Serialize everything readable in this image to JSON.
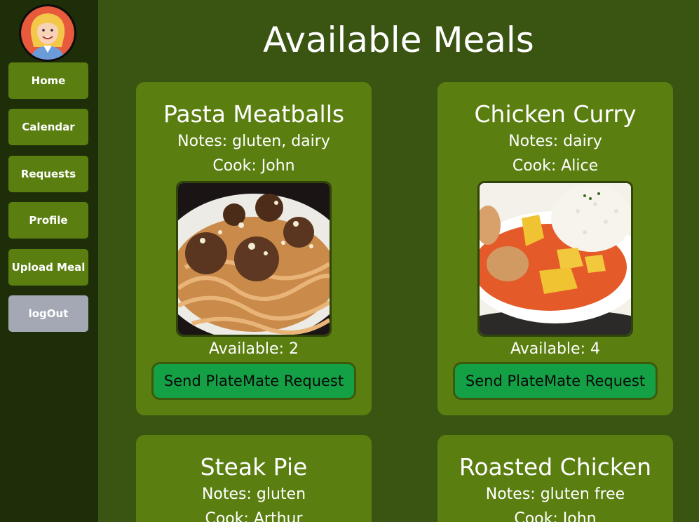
{
  "nav": {
    "home": "Home",
    "calendar": "Calendar",
    "requests": "Requests",
    "profile": "Profile",
    "upload_meal": "Upload Meal",
    "logout": "logOut"
  },
  "page": {
    "title": "Available Meals"
  },
  "meals": [
    {
      "name": "Pasta Meatballs",
      "notes": "Notes: gluten, dairy",
      "cook": "Cook: John",
      "available": "Available: 2",
      "button": "Send PlateMate Request"
    },
    {
      "name": "Chicken Curry",
      "notes": "Notes: dairy",
      "cook": "Cook: Alice",
      "available": "Available: 4",
      "button": "Send PlateMate Request"
    },
    {
      "name": "Steak Pie",
      "notes": "Notes: gluten",
      "cook": "Cook: Arthur"
    },
    {
      "name": "Roasted Chicken",
      "notes": "Notes: gluten free",
      "cook": "Cook: John"
    }
  ],
  "colors": {
    "page_bg": "#3a5412",
    "sidebar_bg": "#1e2e08",
    "card_bg": "#5a7e10",
    "request_button": "#14a045",
    "logout_button": "#a3a8b4"
  }
}
